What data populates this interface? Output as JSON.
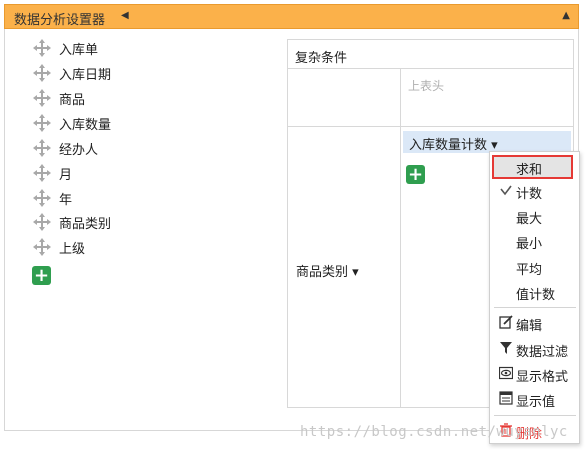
{
  "header": {
    "title": "数据分析设置器",
    "title_arrow": "◀",
    "collapse": "▲"
  },
  "fields": [
    {
      "label": "入库单"
    },
    {
      "label": "入库日期"
    },
    {
      "label": "商品"
    },
    {
      "label": "入库数量"
    },
    {
      "label": "经办人"
    },
    {
      "label": "月"
    },
    {
      "label": "年"
    },
    {
      "label": "商品类别"
    },
    {
      "label": "上级"
    }
  ],
  "add_symbol": "+",
  "pivot": {
    "title": "复杂条件",
    "column_header_placeholder": "上表头",
    "row_field": "商品类别 ▾",
    "value_field": "入库数量计数 ▾"
  },
  "context_menu": {
    "aggregations": [
      {
        "label": "求和",
        "selected": true
      },
      {
        "label": "计数",
        "checked": true
      },
      {
        "label": "最大"
      },
      {
        "label": "最小"
      },
      {
        "label": "平均"
      },
      {
        "label": "值计数"
      }
    ],
    "actions": [
      {
        "label": "编辑",
        "icon": "edit-icon"
      },
      {
        "label": "数据过滤",
        "icon": "filter-icon"
      },
      {
        "label": "显示格式",
        "icon": "eye-icon"
      },
      {
        "label": "显示值",
        "icon": "list-icon"
      }
    ],
    "delete": {
      "label": "删除",
      "icon": "trash-icon"
    }
  },
  "watermark": "https://blog.csdn.net/wuyanlyc",
  "colors": {
    "header_bg": "#fbb14a",
    "add_button": "#2f9e4f",
    "value_field_bg": "#dbe8f7",
    "selected_outline": "#e53935"
  }
}
